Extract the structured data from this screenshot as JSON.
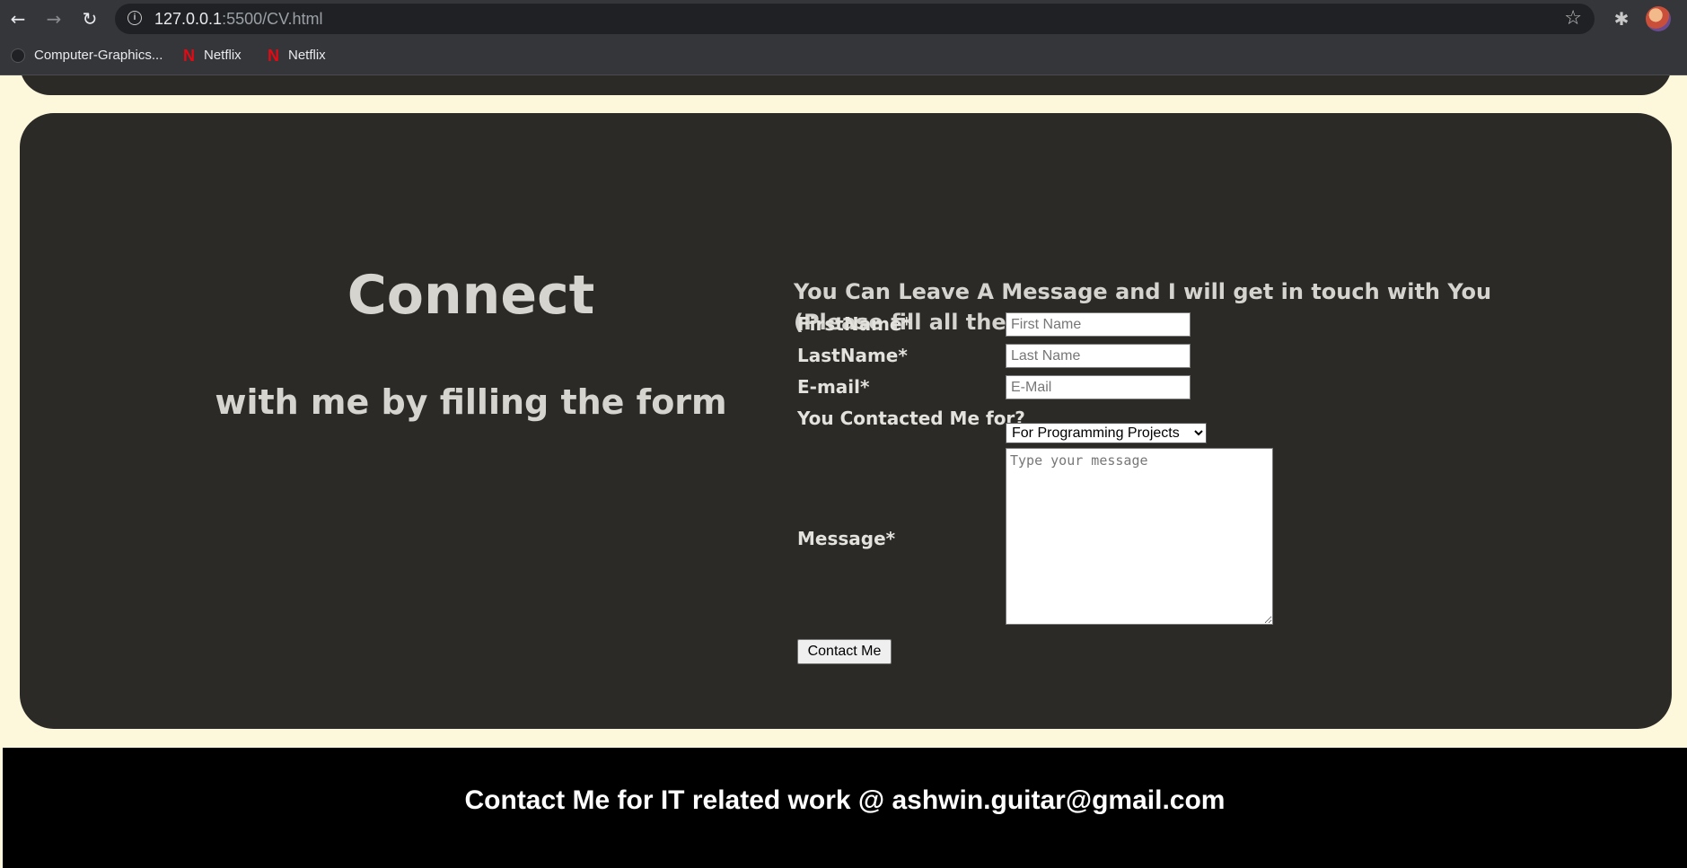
{
  "browser": {
    "url_host": "127.0.0.1",
    "url_path": ":5500/CV.html",
    "bookmarks": [
      {
        "label": "Computer-Graphics...",
        "icon": "github-icon"
      },
      {
        "label": "Netflix",
        "icon": "netflix-icon"
      },
      {
        "label": "Netflix",
        "icon": "netflix-icon"
      }
    ],
    "back_glyph": "←",
    "forward_glyph": "→",
    "reload_glyph": "↻",
    "star_glyph": "☆",
    "extension_glyph": "✱",
    "netflix_glyph": "N"
  },
  "connect": {
    "title": "Connect",
    "subtitle": "with me by filling the form"
  },
  "form": {
    "intro": "You Can Leave A Message and I will get in touch with You (Please fill all the boxes)",
    "first_name_label": "FirstName*",
    "first_name_placeholder": "First Name",
    "last_name_label": "LastName*",
    "last_name_placeholder": "Last Name",
    "email_label": "E-mail*",
    "email_placeholder": "E-Mail",
    "reason_label": "You Contacted Me for?",
    "reason_selected": "For Programming Projects",
    "message_label": "Message*",
    "message_placeholder": "Type your message",
    "submit_label": "Contact Me"
  },
  "footer": {
    "text": "Contact Me for IT related work @ ashwin.guitar@gmail.com"
  }
}
